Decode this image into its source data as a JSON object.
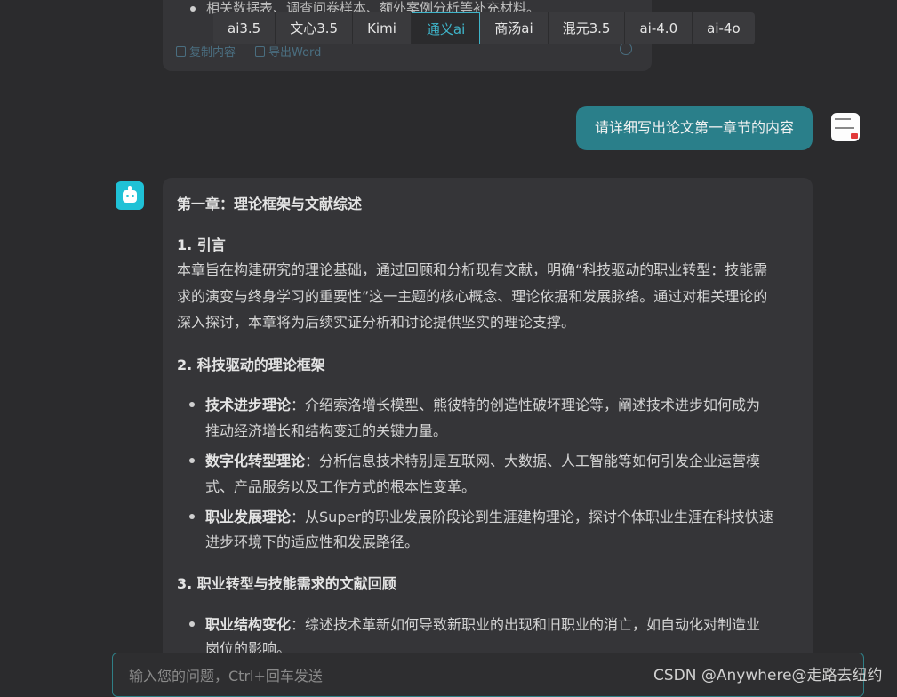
{
  "previous_message": {
    "bullet_fragment": "相关数据表、调查问卷样本、额外案例分析等补充材料。",
    "copy_label": "复制内容",
    "export_label": "导出Word"
  },
  "model_tabs": [
    {
      "label": "ai3.5",
      "active": false
    },
    {
      "label": "文心3.5",
      "active": false
    },
    {
      "label": "Kimi",
      "active": false
    },
    {
      "label": "通义ai",
      "active": true
    },
    {
      "label": "商汤ai",
      "active": false
    },
    {
      "label": "混元3.5",
      "active": false
    },
    {
      "label": "ai-4.0",
      "active": false
    },
    {
      "label": "ai-4o",
      "active": false
    }
  ],
  "user_message": "请详细写出论文第一章节的内容",
  "answer": {
    "chapter_title": "第一章：理论框架与文献综述",
    "s1_heading": "1. 引言",
    "s1_lines": [
      "本章旨在构建研究的理论基础，通过回顾和分析现有文献，明确“科技驱动的职业转型：技能需",
      "求的演变与终身学习的重要性”这一主题的核心概念、理论依据和发展脉络。通过对相关理论的",
      "深入探讨，本章将为后续实证分析和讨论提供坚实的理论支撑。"
    ],
    "s2_heading": "2. 科技驱动的理论框架",
    "s2_items": [
      {
        "term": "技术进步理论",
        "line1": "：介绍索洛增长模型、熊彼特的创造性破坏理论等，阐述技术进步如何成为",
        "line2": "推动经济增长和结构变迁的关键力量。"
      },
      {
        "term": "数字化转型理论",
        "line1": "：分析信息技术特别是互联网、大数据、人工智能等如何引发企业运营模",
        "line2": "式、产品服务以及工作方式的根本性变革。"
      },
      {
        "term": "职业发展理论",
        "line1": "：从Super的职业发展阶段论到生涯建构理论，探讨个体职业生涯在科技快速",
        "line2": "进步环境下的适应性和发展路径。"
      }
    ],
    "s3_heading": "3. 职业转型与技能需求的文献回顾",
    "s3_items": [
      {
        "term": "职业结构变化",
        "line1": "：综述技术革新如何导致新职业的出现和旧职业的消亡，如自动化对制造业",
        "line2": "岗位的影响。"
      }
    ]
  },
  "input": {
    "placeholder": "输入您的问题，Ctrl+回车发送"
  },
  "watermark": "CSDN @Anywhere@走路去纽约"
}
